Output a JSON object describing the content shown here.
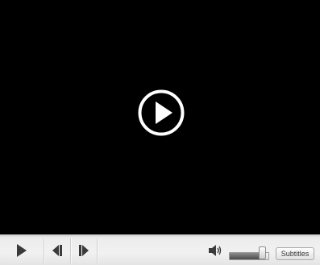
{
  "video": {
    "state": "paused"
  },
  "controls": {
    "volume_level": 0.85,
    "subtitles_label": "Subtitles"
  },
  "colors": {
    "video_background": "#000000",
    "control_bar": "#ececec",
    "icon": "#3a3a3a",
    "overlay_icon": "#ffffff"
  },
  "icons": [
    "play-overlay-icon",
    "play-icon",
    "previous-icon",
    "next-icon",
    "volume-icon"
  ]
}
